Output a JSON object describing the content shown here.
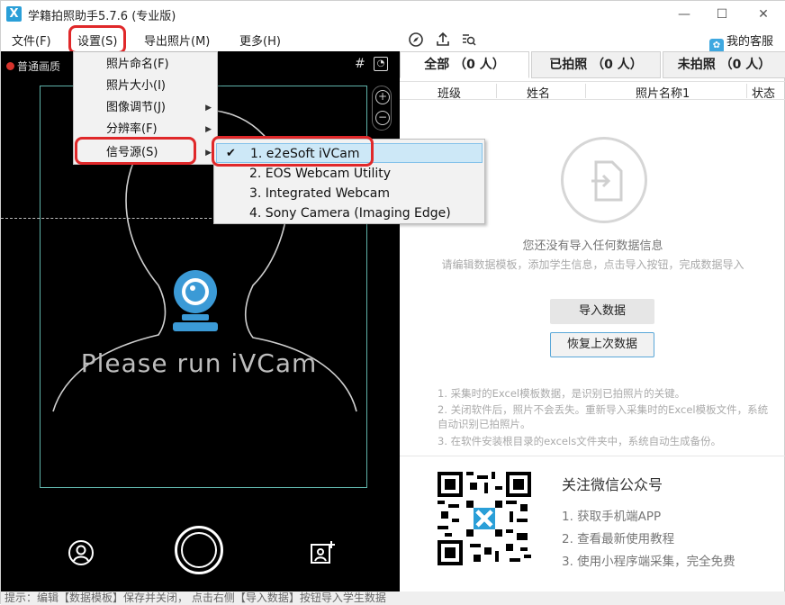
{
  "window": {
    "title": "学籍拍照助手5.7.6 (专业版)",
    "icon_text": "X"
  },
  "menubar": {
    "file": "文件(F)",
    "settings": "设置(S)",
    "export": "导出照片(M)",
    "more": "更多(H)",
    "service": "我的客服"
  },
  "settings_menu": {
    "items": [
      "照片命名(F)",
      "照片大小(I)",
      "图像调节(J)",
      "分辨率(F)",
      "信号源(S)"
    ]
  },
  "signal_menu": {
    "items": [
      "1. e2eSoft iVCam",
      "2. EOS Webcam Utility",
      "3. Integrated Webcam",
      "4. Sony Camera (Imaging Edge)"
    ],
    "selected_index": 0
  },
  "camera": {
    "quality": "普通画质",
    "message": "Please run iVCam"
  },
  "tabs": [
    {
      "label": "全部 （0 人）"
    },
    {
      "label": "已拍照 （0 人）"
    },
    {
      "label": "未拍照 （0 人）"
    }
  ],
  "table": {
    "headers": [
      "班级",
      "姓名",
      "照片名称1",
      "状态"
    ]
  },
  "empty": {
    "title": "您还没有导入任何数据信息",
    "subtitle": "请编辑数据模板，添加学生信息，点击导入按钮，完成数据导入"
  },
  "buttons": {
    "import": "导入数据",
    "restore": "恢复上次数据"
  },
  "tips": [
    "1. 采集时的Excel模板数据，是识别已拍照片的关键。",
    "2. 关闭软件后，照片不会丢失。重新导入采集时的Excel模板文件，系统自动识别已拍照片。",
    "3. 在软件安装根目录的excels文件夹中，系统自动生成备份。"
  ],
  "wechat": {
    "title": "关注微信公众号",
    "items": [
      "1. 获取手机端APP",
      "2. 查看最新使用教程",
      "3. 使用小程序端采集，完全免费"
    ]
  },
  "statusbar": {
    "text": "提示：编辑【数据模板】保存并关闭，  点击右侧【导入数据】按钮导入学生数据"
  },
  "colors": {
    "highlight": "#e0282a",
    "frame": "#5fb3aa",
    "accent": "#2a9fd8",
    "selected_row": "#cde8f7"
  }
}
